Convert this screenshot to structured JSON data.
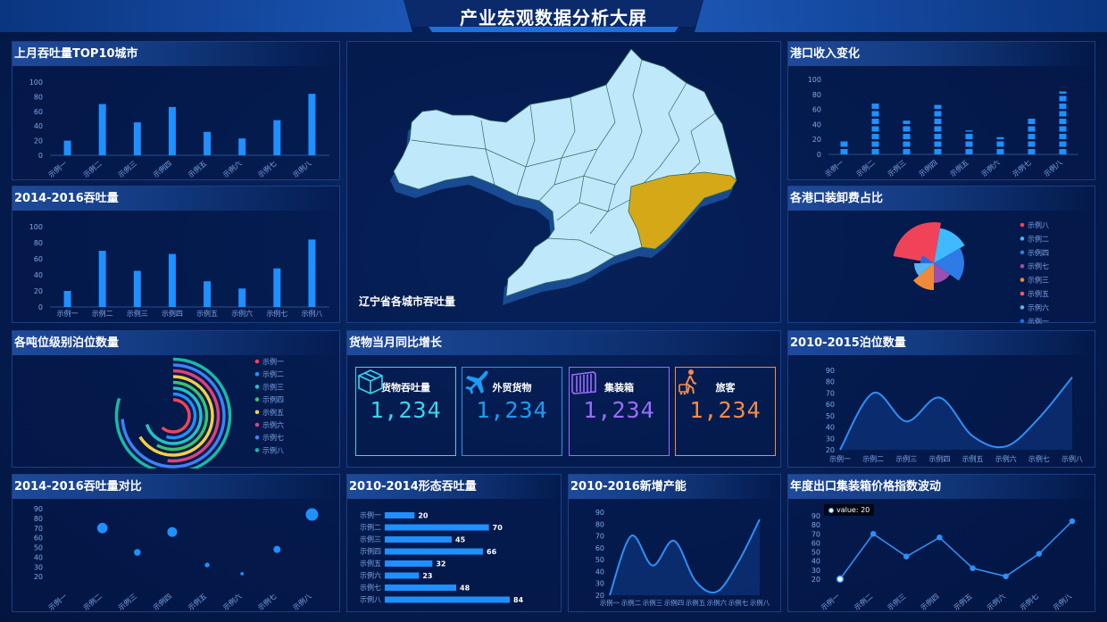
{
  "title": "产业宏观数据分析大屏",
  "colors": {
    "accent": "#1e90ff",
    "bar": "#1e90ff",
    "map_fill": "#bfe8fb",
    "map_highlight": "#d4a817",
    "kpi_cyan": "#38d6f0",
    "kpi_blue": "#1a9cf5",
    "kpi_purple": "#9a6cff",
    "kpi_orange": "#f38c4a"
  },
  "panels": {
    "top10": {
      "title": "上月吞吐量TOP10城市"
    },
    "throughput1416": {
      "title": "2014-2016吞吐量"
    },
    "berth_level": {
      "title": "各吨位级别泊位数量"
    },
    "compare1416": {
      "title": "2014-2016吞吐量对比"
    },
    "map": {
      "caption": "辽宁省各城市吞吐量"
    },
    "growth": {
      "title": "货物当月同比增长"
    },
    "form1014": {
      "title": "2010-2014形态吞吐量"
    },
    "capacity1016": {
      "title": "2010-2016新增产能"
    },
    "port_income": {
      "title": "港口收入变化"
    },
    "loading_fee": {
      "title": "各港口装卸费占比"
    },
    "berth1015": {
      "title": "2010-2015泊位数量"
    },
    "export_index": {
      "title": "年度出口集装箱价格指数波动",
      "tooltip": "value: 20"
    }
  },
  "kpis": [
    {
      "label": "货物吞吐量",
      "value": "1,234",
      "color": "#38d6f0",
      "icon": "box-icon"
    },
    {
      "label": "外贸货物",
      "value": "1,234",
      "color": "#1a9cf5",
      "icon": "airplane-icon"
    },
    {
      "label": "集装箱",
      "value": "1,234",
      "color": "#9a6cff",
      "icon": "container-icon"
    },
    {
      "label": "旅客",
      "value": "1,234",
      "color": "#f38c4a",
      "icon": "traveler-icon"
    }
  ],
  "chart_data": [
    {
      "id": "top10",
      "type": "bar",
      "title": "上月吞吐量TOP10城市",
      "categories": [
        "示例一",
        "示例二",
        "示例三",
        "示例四",
        "示例五",
        "示例六",
        "示例七",
        "示例八"
      ],
      "values": [
        20,
        70,
        45,
        66,
        32,
        23,
        48,
        84
      ],
      "ylim": [
        0,
        100
      ],
      "yticks": [
        0,
        20,
        40,
        60,
        80,
        100
      ]
    },
    {
      "id": "throughput1416",
      "type": "bar",
      "title": "2014-2016吞吐量",
      "categories": [
        "示例一",
        "示例二",
        "示例三",
        "示例四",
        "示例五",
        "示例六",
        "示例七",
        "示例八"
      ],
      "values": [
        20,
        70,
        45,
        66,
        32,
        23,
        48,
        84
      ],
      "ylim": [
        0,
        100
      ],
      "yticks": [
        0,
        20,
        40,
        60,
        80,
        100
      ]
    },
    {
      "id": "berth_level",
      "type": "pie",
      "title": "各吨位级别泊位数量",
      "categories": [
        "示例一",
        "示例二",
        "示例三",
        "示例四",
        "示例五",
        "示例六",
        "示例七",
        "示例八"
      ],
      "legend_colors": [
        "#f0435a",
        "#1e90ff",
        "#20c3c9",
        "#39c46b",
        "#f4d03f",
        "#e0407a",
        "#3b82f6",
        "#18b9a8"
      ]
    },
    {
      "id": "compare1416",
      "type": "scatter",
      "title": "2014-2016吞吐量对比",
      "categories": [
        "示例一",
        "示例二",
        "示例三",
        "示例四",
        "示例五",
        "示例六",
        "示例七",
        "示例八"
      ],
      "values": [
        null,
        70,
        45,
        66,
        32,
        23,
        48,
        84
      ],
      "ylim": [
        10,
        90
      ],
      "yticks": [
        20,
        30,
        40,
        50,
        60,
        70,
        80,
        90
      ]
    },
    {
      "id": "form1014",
      "type": "bar",
      "title": "2010-2014形态吞吐量",
      "categories": [
        "示例一",
        "示例二",
        "示例三",
        "示例四",
        "示例五",
        "示例六",
        "示例七",
        "示例八"
      ],
      "values": [
        20,
        70,
        45,
        66,
        32,
        23,
        48,
        84
      ]
    },
    {
      "id": "capacity1016",
      "type": "area",
      "title": "2010-2016新增产能",
      "categories": [
        "示例一",
        "示例二",
        "示例三",
        "示例四",
        "示例五",
        "示例六",
        "示例七",
        "示例八"
      ],
      "values": [
        20,
        70,
        45,
        66,
        32,
        23,
        48,
        84
      ],
      "ylim": [
        20,
        90
      ],
      "yticks": [
        20,
        30,
        40,
        50,
        60,
        70,
        80,
        90
      ]
    },
    {
      "id": "port_income",
      "type": "bar",
      "title": "港口收入变化",
      "categories": [
        "示例一",
        "示例二",
        "示例三",
        "示例四",
        "示例五",
        "示例六",
        "示例七",
        "示例八"
      ],
      "values": [
        20,
        70,
        45,
        66,
        32,
        23,
        48,
        84
      ],
      "ylim": [
        0,
        100
      ],
      "yticks": [
        0,
        20,
        40,
        60,
        80,
        100
      ]
    },
    {
      "id": "loading_fee",
      "type": "pie",
      "title": "各港口装卸费占比",
      "categories": [
        "示例八",
        "示例二",
        "示例四",
        "示例七",
        "示例三",
        "示例五",
        "示例六",
        "示例一"
      ],
      "legend_colors": [
        "#f0435a",
        "#3fb9ff",
        "#2d7be6",
        "#9b4fb0",
        "#f08a3a",
        "#f05a6a",
        "#5ab4f0",
        "#1e6fe0"
      ]
    },
    {
      "id": "berth1015",
      "type": "area",
      "title": "2010-2015泊位数量",
      "categories": [
        "示例一",
        "示例二",
        "示例三",
        "示例四",
        "示例五",
        "示例六",
        "示例七",
        "示例八"
      ],
      "values": [
        20,
        70,
        45,
        66,
        32,
        23,
        48,
        84
      ],
      "ylim": [
        20,
        90
      ],
      "yticks": [
        20,
        30,
        40,
        50,
        60,
        70,
        80,
        90
      ]
    },
    {
      "id": "export_index",
      "type": "line",
      "title": "年度出口集装箱价格指数波动",
      "categories": [
        "示例一",
        "示例二",
        "示例三",
        "示例四",
        "示例五",
        "示例六",
        "示例七",
        "示例八"
      ],
      "values": [
        20,
        70,
        45,
        66,
        32,
        23,
        48,
        84
      ],
      "ylim": [
        10,
        90
      ],
      "yticks": [
        20,
        30,
        40,
        50,
        60,
        70,
        80,
        90
      ]
    }
  ]
}
